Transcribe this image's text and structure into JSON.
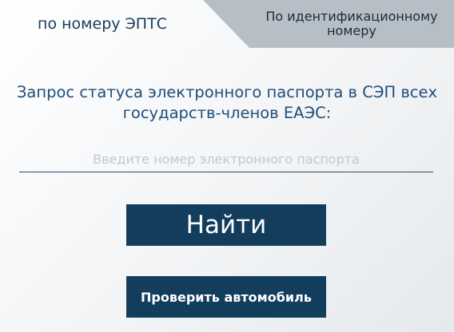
{
  "tabs": {
    "by_epts": "по номеру ЭПТС",
    "by_vin": "По идентификационному номеру"
  },
  "heading": "Запрос статуса электронного паспорта в СЭП всех государств-членов ЕАЭС:",
  "search": {
    "value": "",
    "placeholder": "Введите номер электронного паспорта"
  },
  "buttons": {
    "find": "Найти",
    "check_car": "Проверить автомобиль"
  },
  "colors": {
    "primary": "#123d5c",
    "heading_text": "#1f4e79",
    "inactive_tab": "#b7bfc6"
  }
}
